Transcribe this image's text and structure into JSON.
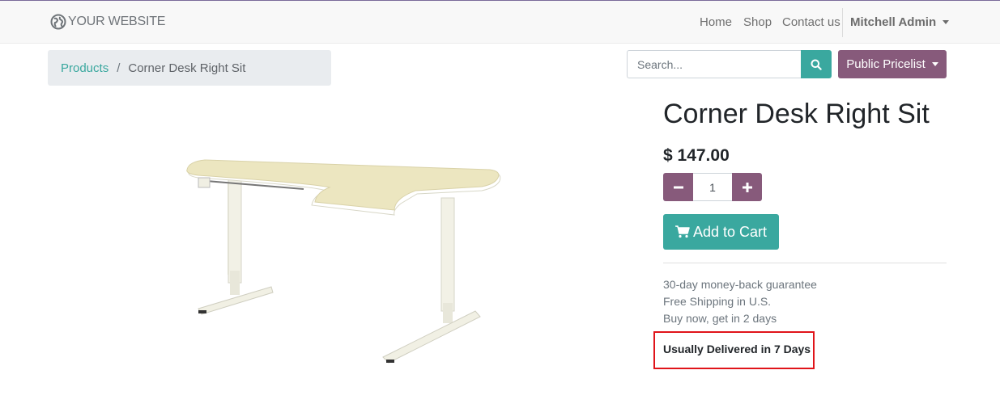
{
  "navbar": {
    "brand": "YOUR WEBSITE",
    "links": [
      "Home",
      "Shop",
      "Contact us"
    ],
    "user": "Mitchell Admin"
  },
  "breadcrumb": {
    "parent": "Products",
    "separator": "/",
    "current": "Corner Desk Right Sit"
  },
  "search": {
    "placeholder": "Search..."
  },
  "pricelist": {
    "label": "Public Pricelist"
  },
  "product": {
    "name": "Corner Desk Right Sit",
    "price": "$ 147.00",
    "quantity": "1",
    "add_to_cart": "Add to Cart",
    "guarantees": [
      "30-day money-back guarantee",
      "Free Shipping in U.S.",
      "Buy now, get in 2 days"
    ],
    "delivery": "Usually Delivered in 7 Days"
  },
  "colors": {
    "primary": "#875a7b",
    "accent": "#3aa89f",
    "highlight": "#e0141a"
  }
}
